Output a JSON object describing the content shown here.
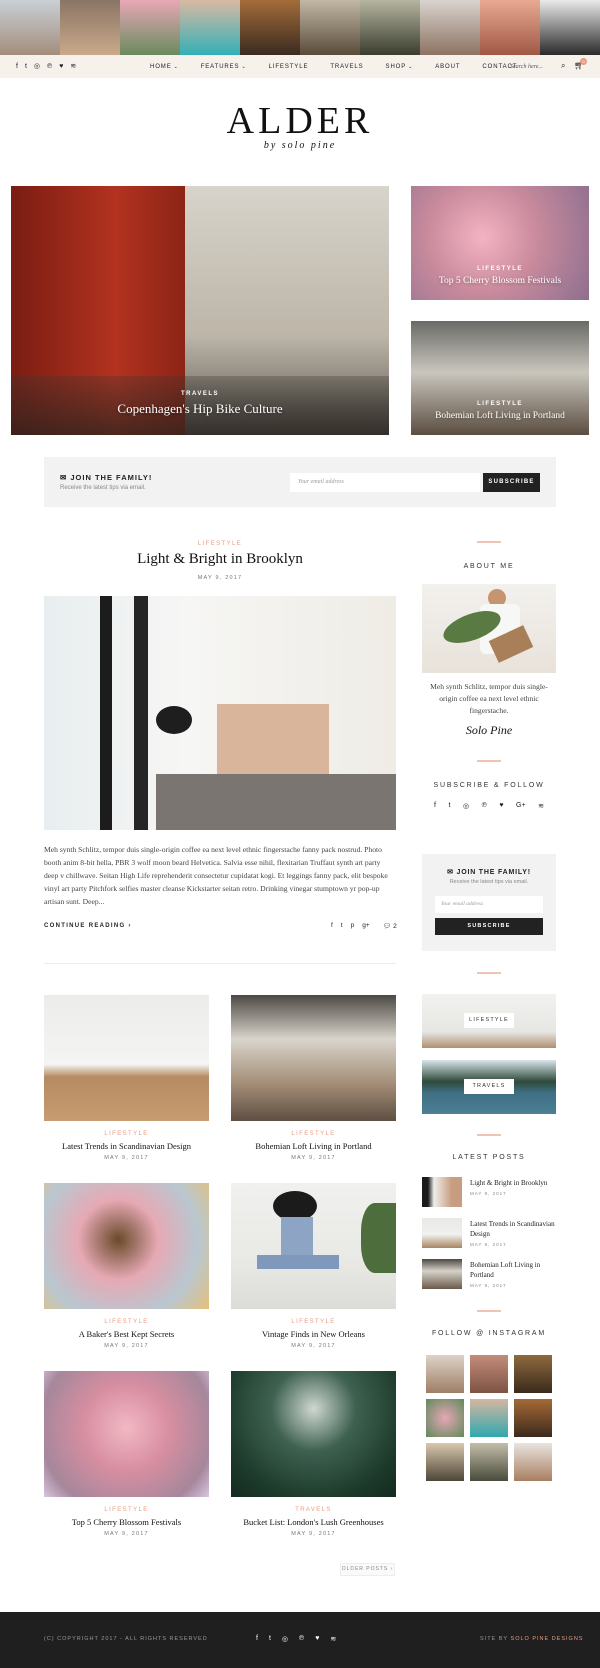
{
  "site": {
    "logo_title": "ALDER",
    "logo_tagline": "by solo pine"
  },
  "colors": {
    "accent": "#e89b84",
    "nav_bg": "#f7f1eb",
    "panel_bg": "#f2f2f2",
    "footer_bg": "#1f1f1f"
  },
  "nav": {
    "social_icons": [
      "facebook-icon",
      "twitter-icon",
      "instagram-icon",
      "pinterest-icon",
      "heart-icon",
      "rss-icon"
    ],
    "menu": [
      {
        "label": "HOME",
        "caret": "⌄"
      },
      {
        "label": "FEATURES",
        "caret": "⌄"
      },
      {
        "label": "LIFESTYLE",
        "caret": ""
      },
      {
        "label": "TRAVELS",
        "caret": ""
      },
      {
        "label": "SHOP",
        "caret": "⌄"
      },
      {
        "label": "ABOUT",
        "caret": ""
      },
      {
        "label": "CONTACT",
        "caret": ""
      }
    ],
    "search_placeholder": "Search here...",
    "cart_count": "0"
  },
  "hero": {
    "main": {
      "category": "TRAVELS",
      "title": "Copenhagen's Hip Bike Culture"
    },
    "side": [
      {
        "category": "LIFESTYLE",
        "title": "Top 5 Cherry Blossom Festivals"
      },
      {
        "category": "LIFESTYLE",
        "title": "Bohemian Loft Living in Portland"
      }
    ]
  },
  "banner": {
    "title": "JOIN THE FAMILY!",
    "subtitle": "Receive the latest tips via email.",
    "input_placeholder": "Your email address",
    "button": "SUBSCRIBE"
  },
  "featured_post": {
    "category": "LIFESTYLE",
    "title": "Light & Bright in Brooklyn",
    "date": "MAY 9, 2017",
    "excerpt": "Meh synth Schlitz, tempor duis single-origin coffee ea next level ethnic fingerstache fanny pack nostrud. Photo booth anim 8-bit hella, PBR 3 wolf moon beard Helvetica. Salvia esse nihil, flexitarian Truffaut synth art party deep v chillwave. Seitan High Life reprehenderit consectetur cupidatat kogi. Et leggings fanny pack, elit bespoke vinyl art party Pitchfork selfies master cleanse Kickstarter seitan retro. Drinking vinegar stumptown yr pop-up artisan sunt. Deep...",
    "continue": "CONTINUE READING ›",
    "share_icons": [
      "f",
      "t",
      "p",
      "g+"
    ],
    "comment_count": "2"
  },
  "grid_posts": [
    {
      "category": "LIFESTYLE",
      "title": "Latest Trends in Scandinavian Design",
      "date": "MAY 9, 2017"
    },
    {
      "category": "LIFESTYLE",
      "title": "Bohemian Loft Living in Portland",
      "date": "MAY 9, 2017"
    },
    {
      "category": "LIFESTYLE",
      "title": "A Baker's Best Kept Secrets",
      "date": "MAY 9, 2017"
    },
    {
      "category": "LIFESTYLE",
      "title": "Vintage Finds in New Orleans",
      "date": "MAY 9, 2017"
    },
    {
      "category": "LIFESTYLE",
      "title": "Top 5 Cherry Blossom Festivals",
      "date": "MAY 9, 2017"
    },
    {
      "category": "TRAVELS",
      "title": "Bucket List: London's Lush Greenhouses",
      "date": "MAY 9, 2017"
    }
  ],
  "older_posts": "OLDER POSTS ›",
  "sidebar": {
    "about_heading": "ABOUT ME",
    "about_text": "Meh synth Schlitz, tempor duis single-origin coffee ea next level ethnic fingerstache.",
    "signature": "Solo Pine",
    "follow_heading": "SUBSCRIBE & FOLLOW",
    "follow_icons": [
      "f",
      "t",
      "◎",
      "℗",
      "♥",
      "G+",
      "≋"
    ],
    "subscribe": {
      "title": "JOIN THE FAMILY!",
      "subtitle": "Receive the latest tips via email.",
      "input_placeholder": "Your email address",
      "button": "SUBSCRIBE"
    },
    "categories": [
      "LIFESTYLE",
      "TRAVELS"
    ],
    "latest_heading": "LATEST POSTS",
    "latest": [
      {
        "title": "Light & Bright in Brooklyn",
        "date": "MAY 9, 2017"
      },
      {
        "title": "Latest Trends in Scandinavian Design",
        "date": "MAY 9, 2017"
      },
      {
        "title": "Bohemian Loft Living in Portland",
        "date": "MAY 9, 2017"
      }
    ],
    "instagram_heading": "FOLLOW @ INSTAGRAM"
  },
  "footer": {
    "copyright": "(C) COPYRIGHT 2017 - ALL RIGHTS RESERVED",
    "credit_prefix": "SITE BY",
    "credit_name": "SOLO PINE DESIGNS",
    "social_icons": [
      "f",
      "t",
      "◎",
      "℗",
      "♥",
      "≋"
    ]
  }
}
